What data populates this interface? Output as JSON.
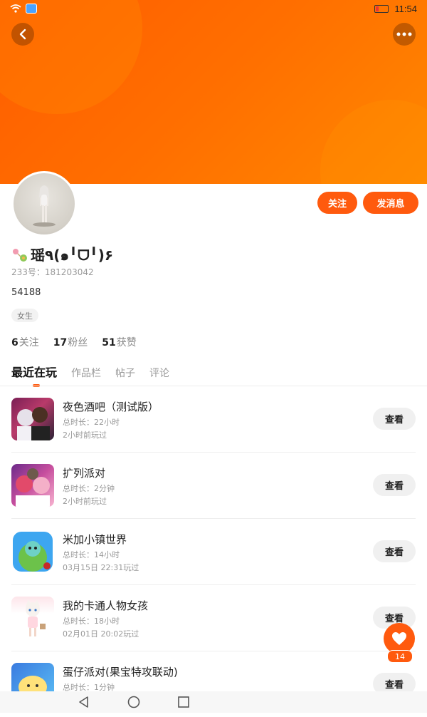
{
  "status_bar": {
    "time": "11:54",
    "icons": [
      "wifi-icon",
      "app-notification-icon",
      "battery-icon"
    ]
  },
  "header": {
    "back_icon": "chevron-left-icon",
    "more_icon": "more-dots-icon",
    "gradient_colors": [
      "#ff5d00",
      "#ff8800"
    ]
  },
  "profile": {
    "username": "瑶٩(๑╹ᗜ╹)۶",
    "uid": "233号：181203042",
    "bio": "54188",
    "gender": "女生",
    "follow_label": "关注",
    "message_label": "发消息",
    "stats": [
      {
        "count": "6",
        "label": "关注"
      },
      {
        "count": "17",
        "label": "粉丝"
      },
      {
        "count": "51",
        "label": "获赞"
      }
    ]
  },
  "tabs": [
    "最近在玩",
    "作品栏",
    "帖子",
    "评论"
  ],
  "games": [
    {
      "title": "夜色酒吧（测试版）",
      "duration": "总时长：22小时",
      "last_played": "2小时前玩过",
      "button": "查看"
    },
    {
      "title": "扩列派对",
      "duration": "总时长：2分钟",
      "last_played": "2小时前玩过",
      "button": "查看"
    },
    {
      "title": "米加小镇世界",
      "duration": "总时长：14小时",
      "last_played": "03月15日 22:31玩过",
      "button": "查看"
    },
    {
      "title": "我的卡通人物女孩",
      "duration": "总时长：18小时",
      "last_played": "02月01日 20:02玩过",
      "button": "查看"
    },
    {
      "title": "蛋仔派对(果宝特攻联动)",
      "duration": "总时长：1分钟",
      "last_played": "",
      "button": "查看"
    }
  ],
  "favorite": {
    "count": "14",
    "icon": "heart-icon"
  },
  "accent_color": "#ff5a0e"
}
